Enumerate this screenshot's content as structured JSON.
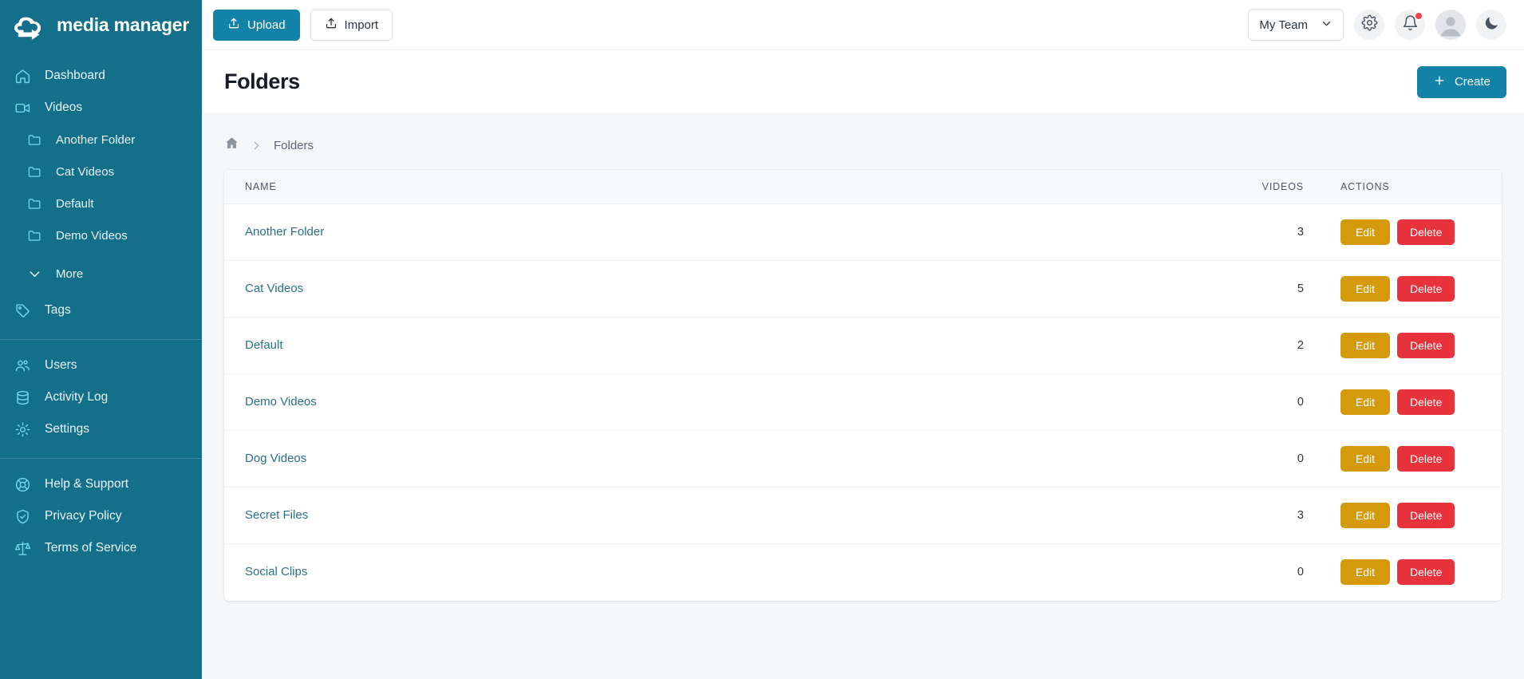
{
  "brand": {
    "name": "media manager",
    "logo_icon": "cloud-upload-logo"
  },
  "sidebar": {
    "primary": [
      {
        "label": "Dashboard",
        "icon": "home-icon",
        "name": "sidebar-item-dashboard"
      },
      {
        "label": "Videos",
        "icon": "video-camera-icon",
        "name": "sidebar-item-videos"
      }
    ],
    "folders": [
      {
        "label": "Another Folder",
        "icon": "folder-icon",
        "name": "sidebar-item-another-folder"
      },
      {
        "label": "Cat Videos",
        "icon": "folder-icon",
        "name": "sidebar-item-cat-videos"
      },
      {
        "label": "Default",
        "icon": "folder-icon",
        "name": "sidebar-item-default"
      },
      {
        "label": "Demo Videos",
        "icon": "folder-icon",
        "name": "sidebar-item-demo-videos"
      }
    ],
    "more": {
      "label": "More",
      "icon": "chevron-down-icon",
      "name": "sidebar-item-more"
    },
    "tags": {
      "label": "Tags",
      "icon": "tag-icon",
      "name": "sidebar-item-tags"
    },
    "admin": [
      {
        "label": "Users",
        "icon": "users-icon",
        "name": "sidebar-item-users"
      },
      {
        "label": "Activity Log",
        "icon": "database-icon",
        "name": "sidebar-item-activity-log"
      },
      {
        "label": "Settings",
        "icon": "gear-icon",
        "name": "sidebar-item-settings"
      }
    ],
    "footer": [
      {
        "label": "Help & Support",
        "icon": "lifebuoy-icon",
        "name": "sidebar-item-help-support"
      },
      {
        "label": "Privacy Policy",
        "icon": "shield-check-icon",
        "name": "sidebar-item-privacy-policy"
      },
      {
        "label": "Terms of Service",
        "icon": "scales-icon",
        "name": "sidebar-item-terms-of-service"
      }
    ]
  },
  "topbar": {
    "upload_label": "Upload",
    "import_label": "Import",
    "team_label": "My Team",
    "icons": {
      "settings": "gear-icon",
      "notifications": "bell-icon",
      "profile": "avatar-icon",
      "theme": "moon-icon"
    }
  },
  "page": {
    "title": "Folders",
    "create_label": "Create"
  },
  "breadcrumb": {
    "home_icon": "home-icon",
    "separator_icon": "chevron-right-icon",
    "current": "Folders"
  },
  "table": {
    "columns": {
      "name": "NAME",
      "videos": "VIDEOS",
      "actions": "ACTIONS"
    },
    "edit_label": "Edit",
    "delete_label": "Delete",
    "rows": [
      {
        "name": "Another Folder",
        "videos": "3"
      },
      {
        "name": "Cat Videos",
        "videos": "5"
      },
      {
        "name": "Default",
        "videos": "2"
      },
      {
        "name": "Demo Videos",
        "videos": "0"
      },
      {
        "name": "Dog Videos",
        "videos": "0"
      },
      {
        "name": "Secret Files",
        "videos": "3"
      },
      {
        "name": "Social Clips",
        "videos": "0"
      }
    ]
  },
  "colors": {
    "sidebar": "#146f8a",
    "accent": "#1283a6",
    "link": "#2a7086",
    "edit": "#d59a0c",
    "delete": "#e8323c",
    "badge": "#f4424a"
  }
}
